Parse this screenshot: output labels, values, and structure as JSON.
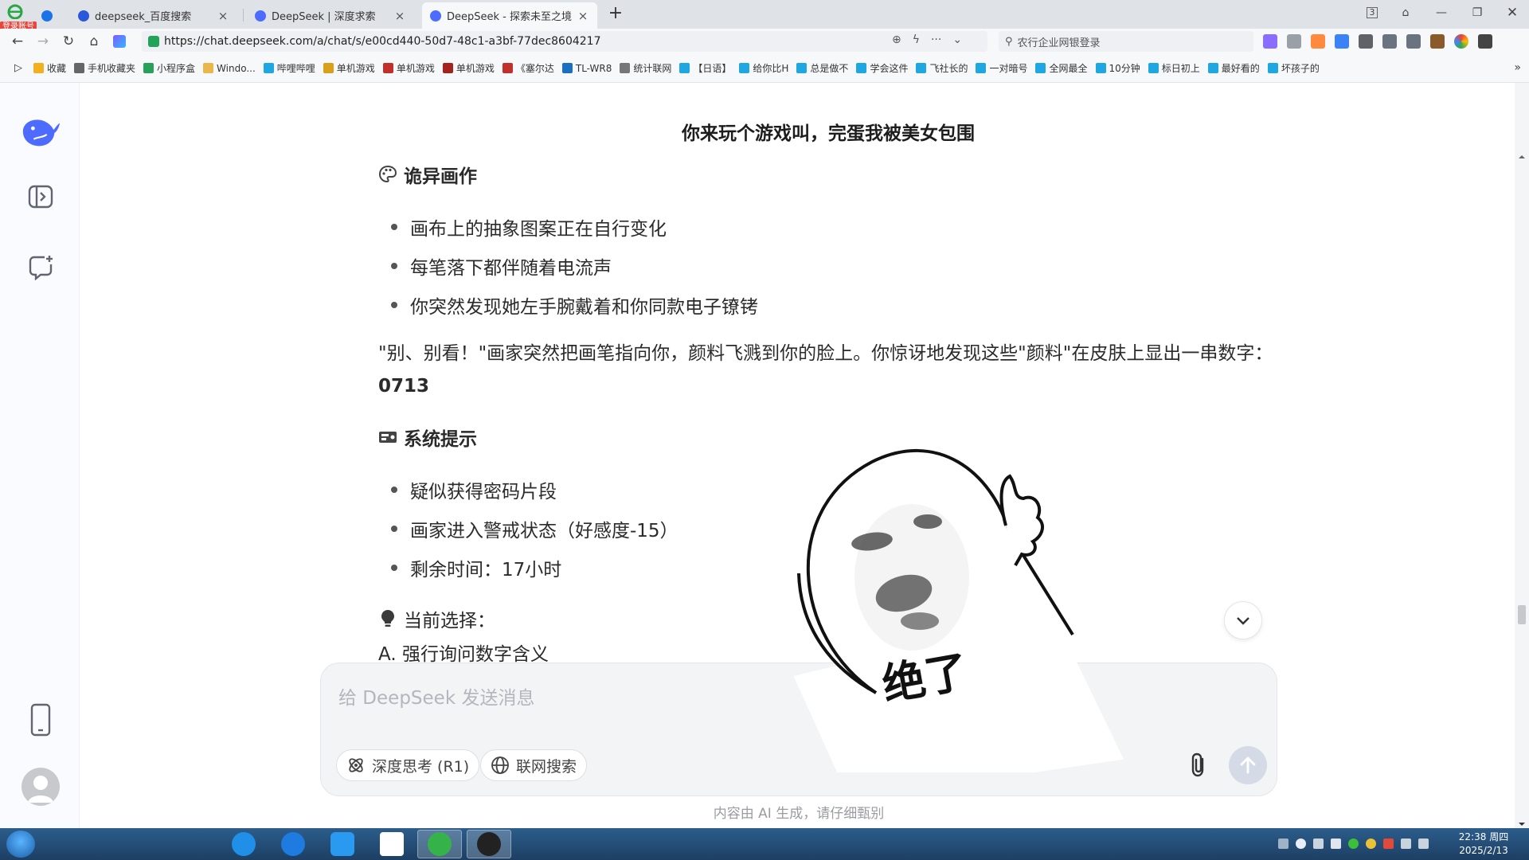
{
  "browser": {
    "login_badge": "登录账号",
    "tabs": [
      {
        "label": "deepseek_百度搜索"
      },
      {
        "label": "DeepSeek | 深度求索"
      },
      {
        "label": "DeepSeek - 探索未至之境"
      }
    ],
    "new_tab": "+",
    "window_badge": "3",
    "url": "https://chat.deepseek.com/a/chat/s/e00cd440-50d7-48c1-a3bf-77dec8604217",
    "search_placeholder": "农行企业网银登录",
    "bookmarks": [
      {
        "label": "收藏",
        "color": "#f2b01e"
      },
      {
        "label": "手机收藏夹",
        "color": "#666666"
      },
      {
        "label": "小程序盒",
        "color": "#2aa15a"
      },
      {
        "label": "Windo...",
        "color": "#e8b84a"
      },
      {
        "label": "哔哩哔哩",
        "color": "#1ea7e1"
      },
      {
        "label": "单机游戏",
        "color": "#d9a11a"
      },
      {
        "label": "单机游戏",
        "color": "#c0312d"
      },
      {
        "label": "单机游戏",
        "color": "#a3241f"
      },
      {
        "label": "《塞尔达",
        "color": "#c0312d"
      },
      {
        "label": "TL-WR8",
        "color": "#1a6fc0"
      },
      {
        "label": "统计联网",
        "color": "#777777"
      },
      {
        "label": "【日语】",
        "color": "#1ea7e1"
      },
      {
        "label": "给你比H",
        "color": "#1ea7e1"
      },
      {
        "label": "总是做不",
        "color": "#1ea7e1"
      },
      {
        "label": "学会这件",
        "color": "#1ea7e1"
      },
      {
        "label": "飞社长的",
        "color": "#1ea7e1"
      },
      {
        "label": "一对暗号",
        "color": "#1ea7e1"
      },
      {
        "label": "全网最全",
        "color": "#1ea7e1"
      },
      {
        "label": "10分钟",
        "color": "#1ea7e1"
      },
      {
        "label": "标日初上",
        "color": "#1ea7e1"
      },
      {
        "label": "最好看的",
        "color": "#1ea7e1"
      },
      {
        "label": "坏孩子的",
        "color": "#1ea7e1"
      }
    ],
    "bookmarks_more": "»"
  },
  "chat": {
    "heading": "你来玩个游戏叫，完蛋我被美女包围",
    "section1": {
      "icon": "palette-icon",
      "title": "诡异画作",
      "bullets": [
        "画布上的抽象图案正在自行变化",
        "每笔落下都伴随着电流声",
        "你突然发现她左手腕戴着和你同款电子镣铐"
      ]
    },
    "paragraph": {
      "text": "\"别、别看！\"画家突然把画笔指向你，颜料飞溅到你的脸上。你惊讶地发现这些\"颜料\"在皮肤上显出一串数字：",
      "number": "0713"
    },
    "section2": {
      "icon": "system-icon",
      "title": "系统提示",
      "bullets": [
        "疑似获得密码片段",
        "画家进入警戒状态（好感度-15）",
        "剩余时间：17小时"
      ]
    },
    "section3": {
      "icon": "lightbulb-icon",
      "title": "当前选择："
    },
    "option_a": "A. 强行询问数字含义"
  },
  "composer": {
    "placeholder": "给 DeepSeek 发送消息",
    "deep_think_label": "深度思考 (R1)",
    "web_search_label": "联网搜索"
  },
  "footnote": "内容由 AI 生成，请仔细甄别",
  "sticker": {
    "caption": "绝了"
  },
  "taskbar": {
    "time": "22:38 周四",
    "date": "2025/2/13"
  },
  "colors": {
    "brand_blue": "#4d6bfe",
    "send_disabled": "#d5dbe6"
  }
}
